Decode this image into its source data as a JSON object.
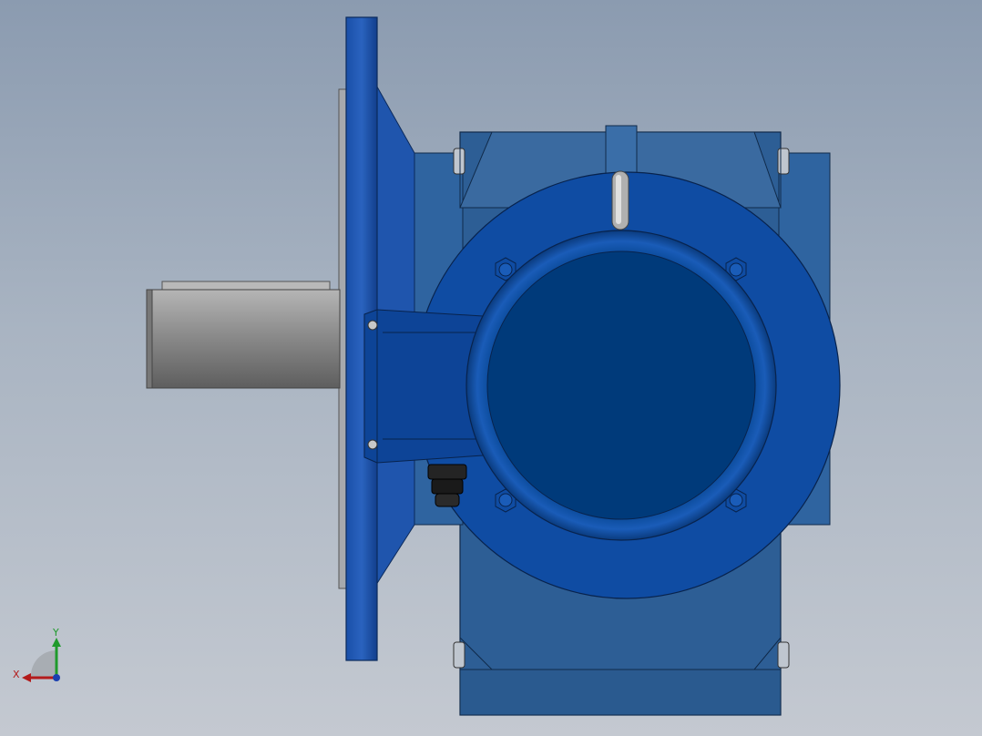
{
  "viewport": {
    "view": "front-view",
    "background_top": "#8b9bb0",
    "background_bottom": "#c4c9d1"
  },
  "model": {
    "name": "worm-gear-reducer",
    "colors": {
      "housing": "#2b5d94",
      "flange": "#1a4ea6",
      "motor_flange": "#0f4ca3",
      "motor_cover": "#003a7a",
      "shaft": "#8c8c8c",
      "plug": "#1c1c1c"
    },
    "parts": [
      "output-flange",
      "output-shaft",
      "gearbox-housing",
      "motor-adapter-flange",
      "motor-end-cover",
      "mounting-bolts",
      "vent-plug",
      "drain-plug",
      "input-bracket"
    ]
  },
  "triad": {
    "x_label": "X",
    "y_label": "Y",
    "x_color": "#b31b1b",
    "y_color": "#1f9a2c"
  }
}
